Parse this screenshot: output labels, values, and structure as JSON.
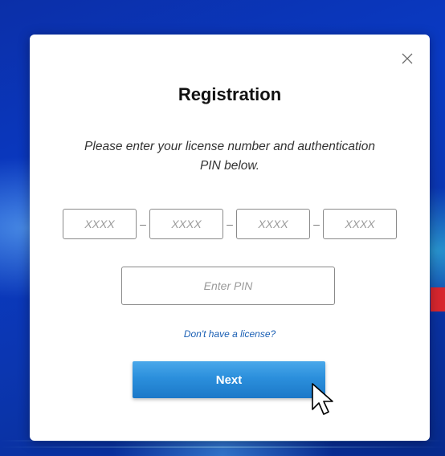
{
  "dialog": {
    "title": "Registration",
    "subtitle": "Please enter your license number and authentication PIN below.",
    "close_icon": "close-icon",
    "license_fields": [
      {
        "placeholder": "XXXX",
        "value": ""
      },
      {
        "placeholder": "XXXX",
        "value": ""
      },
      {
        "placeholder": "XXXX",
        "value": ""
      },
      {
        "placeholder": "XXXX",
        "value": ""
      }
    ],
    "separator": "–",
    "pin": {
      "placeholder": "Enter PIN",
      "value": ""
    },
    "license_link": "Don't have a license?",
    "next_label": "Next"
  },
  "colors": {
    "background": "#0a3ac4",
    "link": "#1a5fb4",
    "button": "#2b8fdc",
    "button_text": "#ffffff"
  },
  "cursor_icon": "mouse-pointer-icon"
}
